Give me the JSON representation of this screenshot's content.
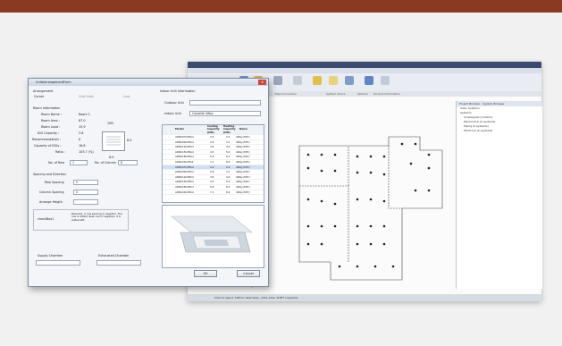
{
  "dialog": {
    "title": "UnitsArrangementForm",
    "close_glyph": "x",
    "arrangement": {
      "heading": "Arrangement",
      "options": [
        "Corner",
        "Grid Units",
        "Line"
      ]
    },
    "room_info": {
      "heading": "Room Information",
      "fields": [
        {
          "label": "Room Name :",
          "value": "Room 1"
        },
        {
          "label": "Room Area :",
          "value": "87.0"
        },
        {
          "label": "Room Load :",
          "value": "15.9"
        },
        {
          "label": "IDU Capacity :",
          "value": "2.8"
        },
        {
          "label": "Recommendation :",
          "value": "6"
        },
        {
          "label": "Capacity of IDUs :",
          "value": "16.8"
        },
        {
          "label": "Ratio :",
          "value": "105.7 (%)"
        }
      ],
      "row_label": "No. of Row",
      "row_value": "1",
      "col_label": "No. of Column",
      "col_value": "6",
      "len_top": "10ft",
      "len_right": "6.0",
      "len_bottom": "6.0"
    },
    "spacing": {
      "heading": "Spacing and Direction",
      "row_label": "Row Spacing",
      "row_value": "0",
      "col_label": "Column Spacing",
      "col_value": "0",
      "height_label": "Arrange Height",
      "height_value": "",
      "check_label": "checkBox1",
      "note": "Basically, A row spacing is negative. The row is added down and if negative, it is added left."
    },
    "supply_label": "Supply Chamber",
    "exhaust_label": "Exhausted Chamber",
    "indoor": {
      "heading": "Indoor Unit Information",
      "outdoor_label": "Outdoor Unit",
      "indoor_label": "Indoor Unit",
      "indoor_value": "Cassette 4Way",
      "columns": [
        "Model",
        "Cooling Capacity [kW]",
        "Heating Capacity [kW]",
        "Name"
      ],
      "rows": [
        {
          "model": "ARNU07GTRA2",
          "cool": "2.0",
          "heat": "2.4",
          "name": "4Way(STD)"
        },
        {
          "model": "ARNU09GTRA2",
          "cool": "2.8",
          "heat": "3.1",
          "name": "4Way(STD)"
        },
        {
          "model": "ARNU12GTRA2",
          "cool": "3.6",
          "heat": "4.0",
          "name": "4Way(STD)"
        },
        {
          "model": "ARNU15GTRA2",
          "cool": "4.5",
          "heat": "5.0",
          "name": "4Way(STD)"
        },
        {
          "model": "ARNU18GTRA2",
          "cool": "5.6",
          "heat": "6.3",
          "name": "4Way(STD)"
        },
        {
          "model": "ARNU24GTPA2",
          "cool": "7.1",
          "heat": "8.0",
          "name": "4Way(STD)"
        },
        {
          "model": "ARNU07GTRC2",
          "cool": "2.0",
          "heat": "2.4",
          "name": "4Way(STD)"
        },
        {
          "model": "ARNU09GTRC2",
          "cool": "2.8",
          "heat": "3.1",
          "name": "4Way(STD)"
        },
        {
          "model": "ARNU12GTRC2",
          "cool": "3.6",
          "heat": "4.0",
          "name": "4Way(STD)"
        },
        {
          "model": "ARNU15GTRC2",
          "cool": "4.5",
          "heat": "5.0",
          "name": "4Way(STD)"
        },
        {
          "model": "ARNU18GTRC2",
          "cool": "5.6",
          "heat": "6.3",
          "name": "4Way(STD)"
        },
        {
          "model": "ARNU24GTRC2",
          "cool": "7.1",
          "heat": "8.0",
          "name": "4Way(STD)"
        }
      ],
      "selected_row": 6
    },
    "ok": "OK",
    "cancel": "Cancel"
  },
  "app": {
    "ribbon_tabs": [
      "Architecture",
      "Structure",
      "Systems",
      "Insert",
      "Annotate",
      "Analyze",
      "Massing & Site",
      "Collaborate",
      "View",
      "Manage",
      "Add-Ins"
    ],
    "panels": [
      "Equipment",
      "Pipe Connection",
      "System Check",
      "Options",
      "Product Information"
    ],
    "side_title": "Project Browser - System Browser",
    "side_view": "View: Systems",
    "tree": [
      "Systems",
      "Unassigned (1 items)",
      "Mechanical (0 systems)",
      "Piping (0 systems)",
      "Electrical (0 systems)"
    ],
    "status": "Click to select, TAB for alternates, CTRL adds, SHIFT unselects.",
    "bottom_hint": "Hardware Rendering Disabled"
  },
  "colors": {
    "top_band": "#8b3a22",
    "selected_row": "#cfe0f5"
  }
}
